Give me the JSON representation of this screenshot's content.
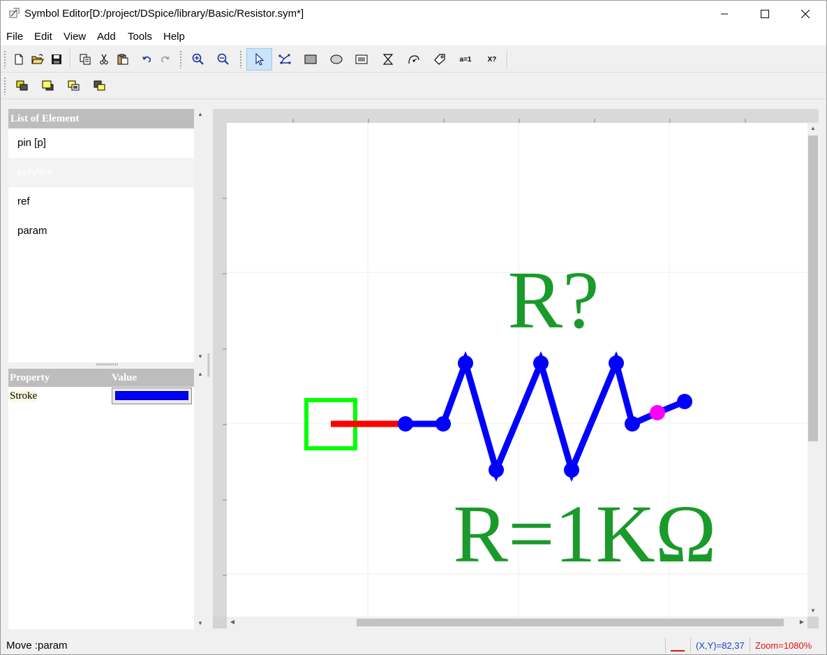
{
  "window": {
    "title": "Symbol Editor[D:/project/DSpice/library/Basic/Resistor.sym*]"
  },
  "menu": [
    "File",
    "Edit",
    "View",
    "Add",
    "Tools",
    "Help"
  ],
  "toolbar": {
    "text_buttons": {
      "param": "a=1",
      "ref": "X?"
    }
  },
  "element_list": {
    "header": "List of Element",
    "items": [
      "pin [p]",
      "polyline",
      "ref",
      "param"
    ],
    "selected": "polyline"
  },
  "properties": {
    "header_property": "Property",
    "header_value": "Value",
    "rows": [
      {
        "name": "Stroke",
        "value_color": "#0000ff"
      }
    ]
  },
  "canvas": {
    "ref_text": "R?",
    "param_text": "R=1KΩ",
    "text_color": "#1a9a2a",
    "stroke_color": "#0000ff",
    "pin_color": "#ff0000",
    "pin_box_color": "#00ff00",
    "handle_color": "#ff00ff"
  },
  "status": {
    "message": "Move :param",
    "coords": "(X,Y)=82,37",
    "zoom": "Zoom=1080%"
  }
}
